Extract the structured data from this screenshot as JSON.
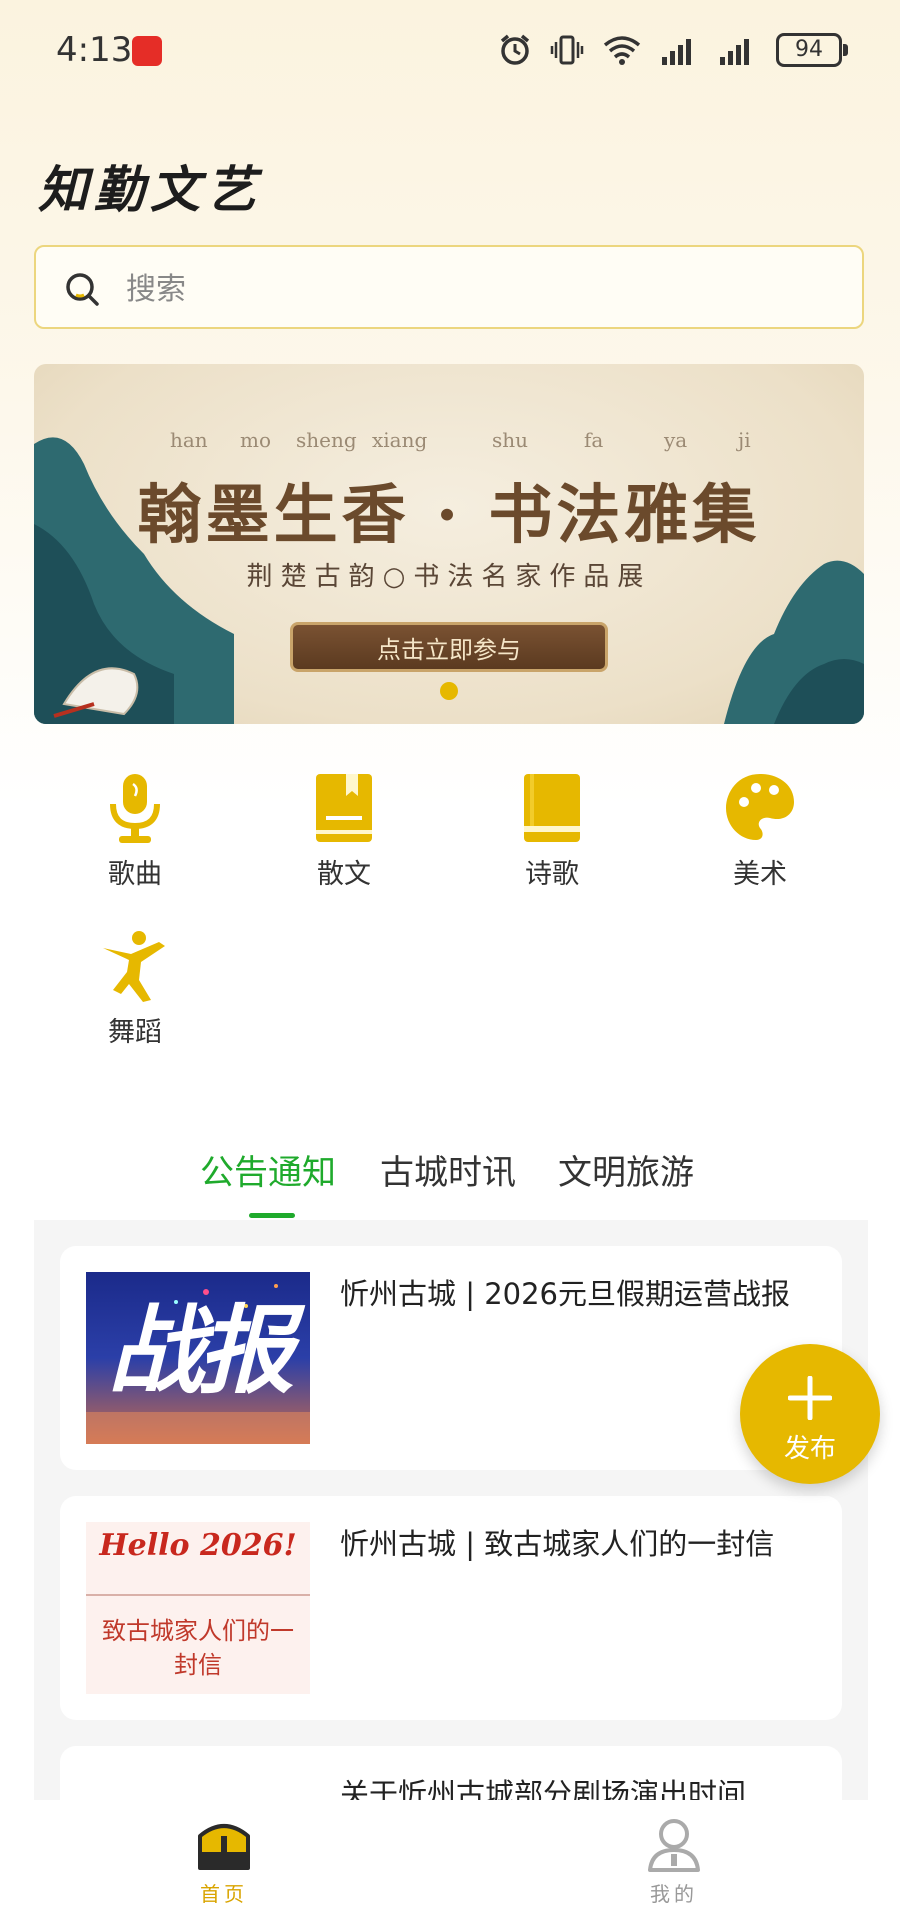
{
  "status_bar": {
    "time": "4:13",
    "battery": "94"
  },
  "app": {
    "title": "知勤文艺"
  },
  "search": {
    "placeholder": "搜索"
  },
  "banner": {
    "pinyin": [
      "han",
      "mo",
      "sheng",
      "xiang",
      "shu",
      "fa",
      "ya",
      "ji"
    ],
    "title": "翰墨生香 · 书法雅集",
    "subtitle": "荆楚古韵○书法名家作品展",
    "cta": "点击立即参与"
  },
  "categories": [
    {
      "label": "歌曲",
      "icon": "microphone-icon"
    },
    {
      "label": "散文",
      "icon": "bookmark-book-icon"
    },
    {
      "label": "诗歌",
      "icon": "book-icon"
    },
    {
      "label": "美术",
      "icon": "palette-icon"
    },
    {
      "label": "舞蹈",
      "icon": "dancer-icon"
    }
  ],
  "tabs": [
    {
      "label": "公告通知",
      "active": true
    },
    {
      "label": "古城时讯",
      "active": false
    },
    {
      "label": "文明旅游",
      "active": false
    }
  ],
  "articles": [
    {
      "title": "忻州古城 | 2026元旦假期运营战报",
      "thumb_text": "战报"
    },
    {
      "title": "忻州古城 | 致古城家人们的一封信",
      "thumb_text": "致古城家人们的一封信",
      "thumb_heading": "Hello 2026!"
    },
    {
      "title": "关于忻州古城部分剧场演出时间"
    }
  ],
  "fab": {
    "label": "发布"
  },
  "bottom_nav": [
    {
      "label": "首页",
      "active": true
    },
    {
      "label": "我的",
      "active": false
    }
  ],
  "colors": {
    "accent": "#e6b800",
    "tab_active": "#1faa2c",
    "banner_brown": "#6b4a2c"
  }
}
